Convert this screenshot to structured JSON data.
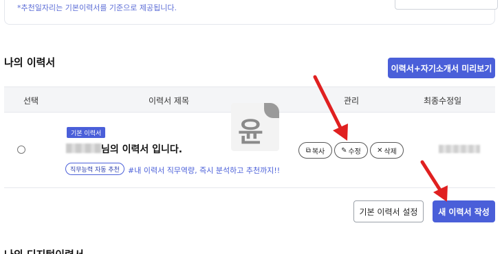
{
  "top_section": {
    "note": "*추천일자리는 기본이력서를 기준으로 제공됩니다."
  },
  "resume_section": {
    "title": "나의 이력서",
    "preview_button": "이력서+자기소개서 미리보기"
  },
  "table": {
    "columns": [
      "선택",
      "이력서 제목",
      "관리",
      "최종수정일"
    ],
    "rows": [
      {
        "badge": "기본 이력서",
        "title_suffix": "님의 이력서 입니다.",
        "tag": "직무능력 자동 추천",
        "hashtag": "#내 이력서 직무역량, 즉시 분석하고 추천까지!!",
        "actions": {
          "copy": "복사",
          "edit": "수정",
          "delete": "삭제"
        }
      }
    ]
  },
  "buttons": {
    "set_default": "기본 이력서 설정",
    "new_resume": "새 이력서 작성"
  },
  "next_section": {
    "title": "나의 디지털이력서"
  },
  "watermark_text": "윤",
  "icons": {
    "copy": "copy-icon",
    "edit": "pencil-icon",
    "delete": "close-icon"
  },
  "colors": {
    "accent": "#4a5fd9",
    "annotation_arrow": "#e02020"
  }
}
